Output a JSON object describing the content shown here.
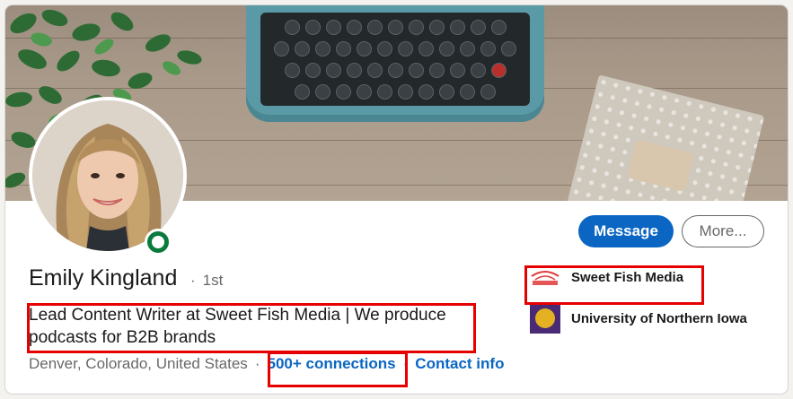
{
  "profile": {
    "name": "Emily Kingland",
    "degree": "1st",
    "headline": "Lead Content Writer at Sweet Fish Media | We produce podcasts for B2B brands",
    "location": "Denver, Colorado, United States",
    "connections": "500+ connections",
    "contact_info": "Contact info",
    "separator": "·",
    "online_status": "online"
  },
  "actions": {
    "message_label": "Message",
    "more_label": "More..."
  },
  "experience": [
    {
      "label": "Sweet Fish Media",
      "logo_text": "sweetfish",
      "icon": "sweet-fish-logo"
    },
    {
      "label": "University of Northern Iowa",
      "logo_text": "University of Northern Iowa",
      "icon": "uni-logo"
    }
  ],
  "colors": {
    "brand": "#0a66c2",
    "online": "#0a7b3d",
    "highlight": "#e60000"
  }
}
